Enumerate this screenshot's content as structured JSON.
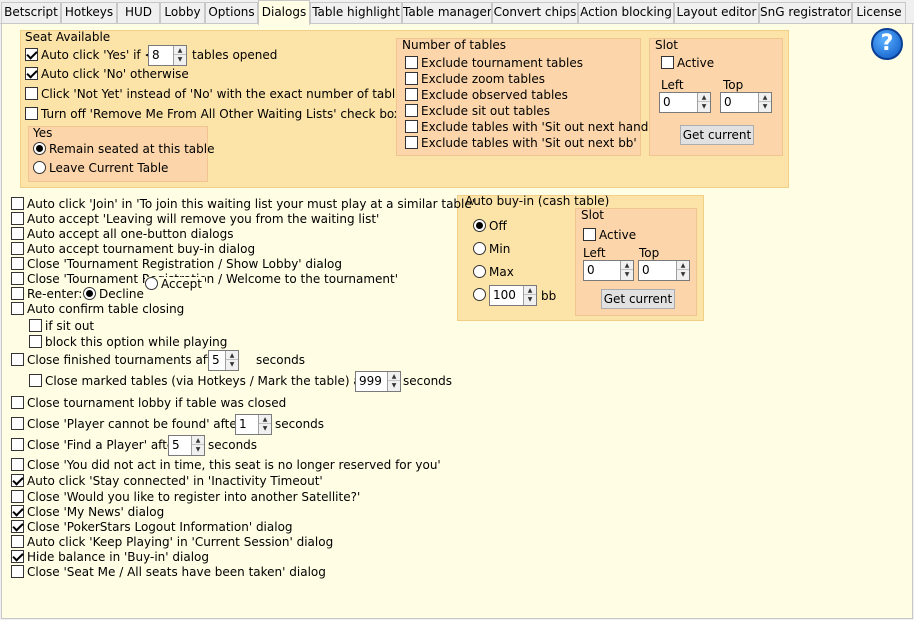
{
  "tabs": [
    {
      "label": "Betscript"
    },
    {
      "label": "Hotkeys"
    },
    {
      "label": "HUD"
    },
    {
      "label": "Lobby"
    },
    {
      "label": "Options"
    },
    {
      "label": "Dialogs"
    },
    {
      "label": "Table highlight"
    },
    {
      "label": "Table manager"
    },
    {
      "label": "Convert chips"
    },
    {
      "label": "Action blocking"
    },
    {
      "label": "Layout editor"
    },
    {
      "label": "SnG registrator"
    },
    {
      "label": "License"
    }
  ],
  "active_tab": "Dialogs",
  "help_icon": "?",
  "seat_available": {
    "title": "Seat Available",
    "auto_yes_prefix": "Auto click 'Yes' if <",
    "auto_yes_value": "8",
    "auto_yes_suffix": "tables opened",
    "auto_no": "Auto click 'No' otherwise",
    "not_yet": "Click 'Not Yet' instead of 'No' with the exact number of tables",
    "turn_off": "Turn off 'Remove Me From All Other Waiting Lists' check box",
    "yes_group": {
      "title": "Yes",
      "remain": "Remain seated at this table",
      "leave": "Leave Current Table"
    },
    "number_of_tables": {
      "title": "Number of tables",
      "items": [
        "Exclude tournament tables",
        "Exclude zoom tables",
        "Exclude observed tables",
        "Exclude sit out tables",
        "Exclude tables with 'Sit out next hand'",
        "Exclude tables with 'Sit out next bb'"
      ]
    },
    "slot": {
      "title": "Slot",
      "active": "Active",
      "left_label": "Left",
      "top_label": "Top",
      "left_value": "0",
      "top_value": "0",
      "get_current": "Get current"
    }
  },
  "auto_buyin": {
    "title": "Auto buy-in (cash table)",
    "off": "Off",
    "min": "Min",
    "max": "Max",
    "amount": "100",
    "bb": "bb",
    "slot": {
      "title": "Slot",
      "active": "Active",
      "left_label": "Left",
      "top_label": "Top",
      "left_value": "0",
      "top_value": "0",
      "get_current": "Get current"
    }
  },
  "options": {
    "join": "Auto click 'Join' in 'To join this waiting list your must play at a similar table'",
    "leaving": "Auto accept 'Leaving will remove you from the waiting list'",
    "one_button": "Auto accept all one-button dialogs",
    "tourney_buyin": "Auto accept tournament buy-in dialog",
    "close_reg_lobby": "Close 'Tournament Registration / Show Lobby' dialog",
    "close_reg_welcome": "Close 'Tournament Registration / Welcome to the tournament'",
    "reenter": "Re-enter:",
    "decline": "Decline",
    "accept": "Accept",
    "confirm_closing": "Auto confirm table closing",
    "if_sit_out": "if sit out",
    "block_option": "block this option while playing",
    "close_finished_prefix": "Close finished tournaments after",
    "close_finished_value": "5",
    "close_finished_suffix": "seconds",
    "close_marked_prefix": "Close marked tables (via Hotkeys / Mark the table) after",
    "close_marked_value": "999",
    "close_marked_suffix": "seconds",
    "close_lobby": "Close tournament lobby if table was closed",
    "player_not_found_prefix": "Close 'Player cannot be found' after",
    "player_not_found_value": "1",
    "player_not_found_suffix": "seconds",
    "find_player_prefix": "Close 'Find a Player' after",
    "find_player_value": "5",
    "find_player_suffix": "seconds",
    "not_act": "Close 'You did not act in time, this seat is no longer reserved for you'",
    "stay_connected": "Auto click 'Stay connected' in 'Inactivity Timeout'",
    "satellite": "Close 'Would you like to register into another Satellite?'",
    "my_news": "Close 'My News' dialog",
    "logout": "Close 'PokerStars Logout Information' dialog",
    "keep_playing": "Auto click 'Keep Playing' in 'Current Session' dialog",
    "hide_balance": "Hide balance in 'Buy-in' dialog",
    "seat_me": "Close 'Seat Me / All seats have been taken' dialog"
  }
}
